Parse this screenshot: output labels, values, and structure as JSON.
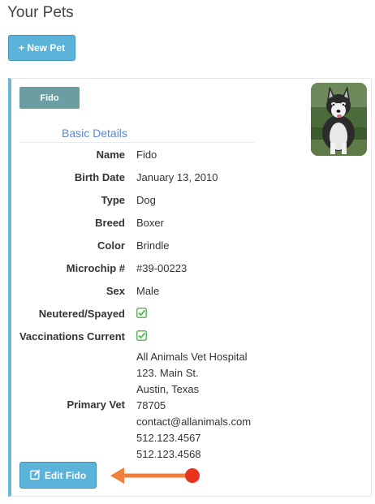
{
  "page": {
    "title": "Your Pets"
  },
  "toolbar": {
    "new_pet_label": "+ New Pet"
  },
  "pet": {
    "name_tab": "Fido",
    "photo_icon": "husky-photo",
    "section_title": "Basic Details",
    "details": [
      {
        "label": "Name",
        "value": "Fido"
      },
      {
        "label": "Birth Date",
        "value": "January 13, 2010"
      },
      {
        "label": "Type",
        "value": "Dog"
      },
      {
        "label": "Breed",
        "value": "Boxer"
      },
      {
        "label": "Color",
        "value": "Brindle"
      },
      {
        "label": "Microchip #",
        "value": "#39-00223"
      },
      {
        "label": "Sex",
        "value": "Male"
      }
    ],
    "checks": [
      {
        "label": "Neutered/Spayed",
        "icon": "checkbox-checked-icon",
        "checked": true
      },
      {
        "label": "Vaccinations Current",
        "icon": "checkbox-checked-icon",
        "checked": true
      }
    ],
    "primary_vet": {
      "label": "Primary Vet",
      "lines": [
        "All Animals Vet Hospital",
        "123. Main St.",
        "Austin, Texas",
        "78705",
        "contact@allanimals.com",
        "512.123.4567",
        "512.123.4568"
      ]
    },
    "edit_label": "Edit Fido",
    "edit_icon": "edit-icon"
  },
  "colors": {
    "button_blue": "#5bb3d9",
    "tab_teal": "#6a9ea2",
    "card_accent": "#6cb7d9",
    "section_title_blue": "#5b87d6",
    "check_green": "#5cb85c",
    "annotation_orange": "#f07f3c",
    "annotation_red": "#e8341c"
  }
}
